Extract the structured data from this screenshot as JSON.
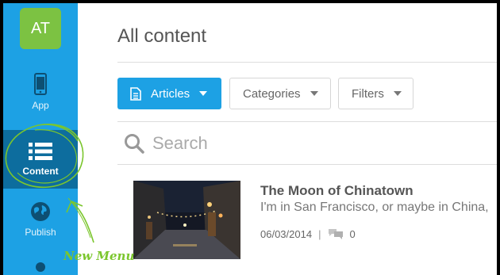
{
  "sidebar": {
    "avatar": "AT",
    "items": [
      {
        "label": "App",
        "icon": "phone-icon"
      },
      {
        "label": "Content",
        "icon": "list-icon",
        "active": true
      },
      {
        "label": "Publish",
        "icon": "globe-icon"
      }
    ]
  },
  "annotation": {
    "text": "New Menu",
    "color": "#7bc62d"
  },
  "main": {
    "title": "All content",
    "toolbar": {
      "articles_label": "Articles",
      "categories_label": "Categories",
      "filters_label": "Filters"
    },
    "search": {
      "placeholder": "Search"
    },
    "items": [
      {
        "title": "The Moon of Chinatown",
        "excerpt": "I'm in San Francisco, or maybe in China,",
        "date": "06/03/2014",
        "separator": "|",
        "comments": "0"
      }
    ]
  },
  "colors": {
    "accent": "#1da1e4",
    "active": "#0d6d9e",
    "avatar": "#7cc242"
  }
}
